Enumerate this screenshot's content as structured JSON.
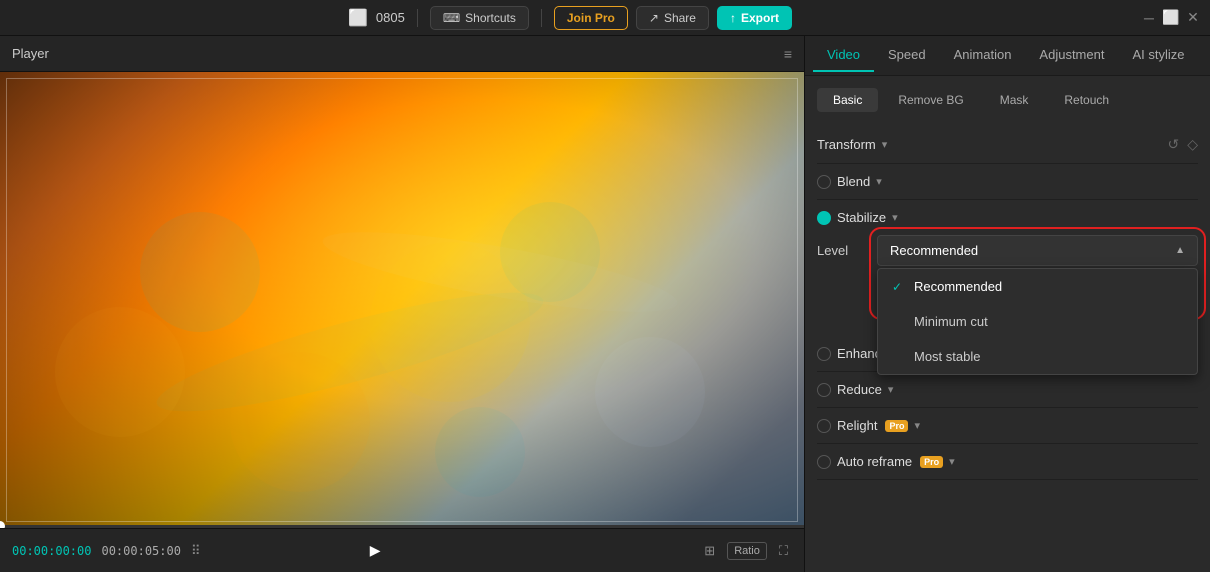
{
  "titleBar": {
    "title": "0805",
    "shortcuts_label": "Shortcuts",
    "join_pro_label": "Join Pro",
    "share_label": "Share",
    "export_label": "Export"
  },
  "player": {
    "title": "Player",
    "time_current": "00:00:00:00",
    "time_total": "00:00:05:00",
    "ratio_label": "Ratio"
  },
  "panel": {
    "tabs": [
      "Video",
      "Speed",
      "Animation",
      "Adjustment",
      "AI stylize"
    ],
    "active_tab": "Video",
    "sub_tabs": [
      "Basic",
      "Remove BG",
      "Mask",
      "Retouch"
    ],
    "active_sub_tab": "Basic"
  },
  "video_settings": {
    "transform_label": "Transform",
    "blend_label": "Blend",
    "stabilize_label": "Stabilize",
    "level_label": "Level",
    "level_selected": "Recommended",
    "level_options": [
      "Recommended",
      "Minimum cut",
      "Most stable"
    ],
    "enhance_label": "Enhance",
    "reduce_label": "Reduce",
    "relight_label": "Relight",
    "reframe_label": "Auto reframe"
  }
}
